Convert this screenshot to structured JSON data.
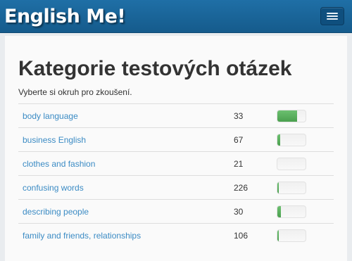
{
  "navbar": {
    "brand": "English Me!",
    "menu_icon": "hamburger-icon"
  },
  "page": {
    "title": "Kategorie testových otázek",
    "subtitle": "Vyberte si okruh pro zkoušení."
  },
  "categories": [
    {
      "name": "body language",
      "count": "33",
      "progress_pct": 70
    },
    {
      "name": "business English",
      "count": "67",
      "progress_pct": 10
    },
    {
      "name": "clothes and fashion",
      "count": "21",
      "progress_pct": 0
    },
    {
      "name": "confusing words",
      "count": "226",
      "progress_pct": 5
    },
    {
      "name": "describing people",
      "count": "30",
      "progress_pct": 12
    },
    {
      "name": "family and friends, relationships",
      "count": "106",
      "progress_pct": 5
    }
  ],
  "colors": {
    "navbar": "#1a6699",
    "link": "#3b8bc4",
    "progress": "#5cb85c"
  }
}
